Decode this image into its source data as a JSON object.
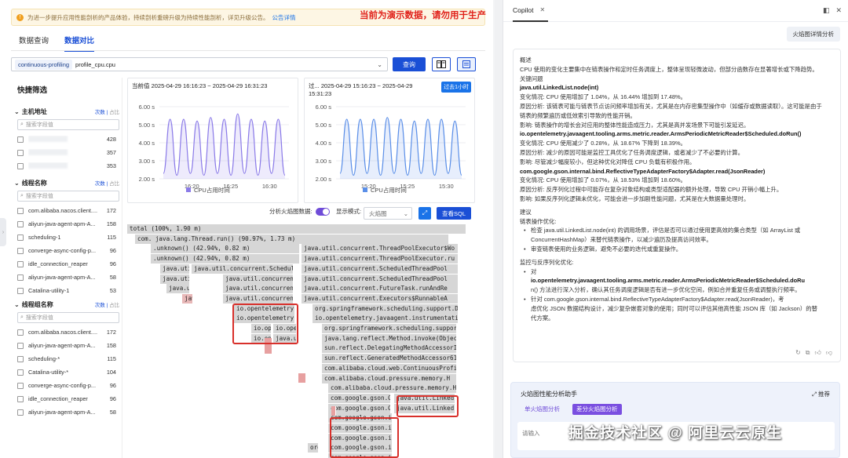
{
  "notice": {
    "text": "为进一步提升应用性能剖析的产品体验，持续剖析重磅升级为持续性能剖析，详见升级公告。",
    "link": "公告详情",
    "demo_warning": "当前为演示数据，请勿用于生产"
  },
  "tabs": [
    {
      "label": "数据查询",
      "active": false
    },
    {
      "label": "数据对比",
      "active": true
    }
  ],
  "query": {
    "chip": "continuous-profiling",
    "profile": "profile_cpu.cpu",
    "button": "查询"
  },
  "filter": {
    "title": "快捷筛选",
    "sort_count": "次数",
    "sort_ratio": "占比",
    "search_placeholder": "搜索字段值",
    "sections": [
      {
        "title": "主机地址",
        "items": [
          {
            "name": "",
            "count": "428"
          },
          {
            "name": "",
            "count": "357"
          },
          {
            "name": "",
            "count": "353"
          }
        ]
      },
      {
        "title": "线程名称",
        "items": [
          {
            "name": "com.alibaba.nacos.client....",
            "count": "172"
          },
          {
            "name": "aliyun-java-agent-apm-A...",
            "count": "158"
          },
          {
            "name": "scheduling-1",
            "count": "115"
          },
          {
            "name": "converge-async-config-p...",
            "count": "96"
          },
          {
            "name": "idle_connection_reaper",
            "count": "96"
          },
          {
            "name": "aliyun-java-agent-apm-A...",
            "count": "58"
          },
          {
            "name": "Catalina-utility-1",
            "count": "53"
          }
        ]
      },
      {
        "title": "线程组名称",
        "items": [
          {
            "name": "com.alibaba.nacos.client....",
            "count": "172"
          },
          {
            "name": "aliyun-java-agent-apm-A...",
            "count": "158"
          },
          {
            "name": "scheduling-*",
            "count": "115"
          },
          {
            "name": "Catalina-utility-*",
            "count": "104"
          },
          {
            "name": "converge-async-config-p...",
            "count": "96"
          },
          {
            "name": "idle_connection_reaper",
            "count": "96"
          },
          {
            "name": "aliyun-java-agent-apm-A...",
            "count": "58"
          }
        ]
      }
    ]
  },
  "charts": {
    "current": {
      "title": "当前值 2025-04-29 16:16:23 ~ 2025-04-29 16:31:23",
      "legend": "CPU占用时间"
    },
    "past": {
      "title_line1": "过... 2025-04-29 15:16:23 ~ 2025-04-29",
      "title_line2": "15:31:23",
      "range_button": "过去1小时",
      "legend": "CPU占用时间"
    }
  },
  "chart_data": [
    {
      "type": "area",
      "title": "",
      "ylabel": "",
      "xlabel": "",
      "ylim": [
        2,
        6
      ],
      "y_ticks": [
        "2.00 s",
        "3.00 s",
        "4.00 s",
        "5.00 s",
        "6.00 s"
      ],
      "x_ticks": [
        "16:20",
        "16:25",
        "16:30"
      ],
      "series": [
        {
          "name": "CPU占用时间",
          "values": [
            2.3,
            5.3,
            2.2,
            5.3,
            2.3,
            5.2,
            2.2,
            5.4,
            2.3,
            5.3,
            2.2,
            5.6,
            2.3,
            5.3,
            2.2,
            5.2,
            2.3,
            5.3,
            2.2
          ]
        }
      ]
    },
    {
      "type": "area",
      "title": "",
      "ylabel": "",
      "xlabel": "",
      "ylim": [
        2,
        6
      ],
      "y_ticks": [
        "2.00 s",
        "3.00 s",
        "4.00 s",
        "5.00 s",
        "6.00 s"
      ],
      "x_ticks": [
        "15:20",
        "15:25",
        "15:30"
      ],
      "series": [
        {
          "name": "CPU占用时间",
          "values": [
            2.3,
            5.3,
            2.2,
            5.3,
            2.3,
            5.3,
            2.2,
            5.4,
            2.3,
            5.3,
            2.2,
            5.2,
            2.3,
            5.3,
            2.2,
            5.3,
            2.3,
            5.2,
            2.2
          ]
        }
      ]
    }
  ],
  "flame_controls": {
    "analyze_label": "分析火焰图数据:",
    "mode_label": "显示模式:",
    "mode_value": "火焰图",
    "sql_button": "查看SQL"
  },
  "flame_rows": [
    {
      "text": "total (100%, 1.90 m)",
      "cls": ""
    },
    {
      "text": "com. java.lang.Thread.run() (90.97%, 1.73 m)",
      "cls": ""
    },
    {
      "text": ".unknown() (42.94%, 0.82 m)",
      "cls": ""
    },
    {
      "text": ".unknown() (42.94%, 0.82 m)",
      "cls": ""
    },
    {
      "text": "java.uti",
      "cls": ""
    },
    {
      "text": "java.util.concurrent.ScheduledT",
      "cls": ""
    },
    {
      "text": "java.uti",
      "cls": ""
    },
    {
      "text": "java.util.concurrent.S",
      "cls": ""
    },
    {
      "text": "java.uti",
      "cls": ""
    },
    {
      "text": "java.util.concurrent.F",
      "cls": ""
    },
    {
      "text": "jav",
      "cls": "pk"
    },
    {
      "text": "java.util.concurrent.E",
      "cls": ""
    },
    {
      "text": "io.opentelemetry.j",
      "cls": ""
    },
    {
      "text": "io.opentelemetry.j",
      "cls": ""
    },
    {
      "text": "io.oper",
      "cls": ""
    },
    {
      "text": "io.oper",
      "cls": ""
    },
    {
      "text": "io.ope",
      "cls": ""
    },
    {
      "text": "java.ut",
      "cls": ""
    },
    {
      "text": "java.util.concurrent.ThreadPoolExecutor$Wo",
      "cls": ""
    },
    {
      "text": "java.util.concurrent.ThreadPoolExecutor.ru",
      "cls": ""
    },
    {
      "text": "java.util.concurrent.ScheduledThreadPool",
      "cls": ""
    },
    {
      "text": "java.util.concurrent.ScheduledThreadPool",
      "cls": ""
    },
    {
      "text": "java.util.concurrent.FutureTask.runAndRe",
      "cls": ""
    },
    {
      "text": "java.util.concurrent.Executors$RunnableA",
      "cls": ""
    },
    {
      "text": "org.springframework.scheduling.support.D",
      "cls": ""
    },
    {
      "text": "io.opentelemetry.javaagent.instrumentatio",
      "cls": ""
    },
    {
      "text": "org.springframework.scheduling.suppor",
      "cls": ""
    },
    {
      "text": "java.lang.reflect.Method.invoke(Objec",
      "cls": ""
    },
    {
      "text": "sun.reflect.DelegatingMethodAccessorI",
      "cls": ""
    },
    {
      "text": "sun.reflect.GeneratedMethodAccessor61",
      "cls": ""
    },
    {
      "text": "com.alibaba.cloud.web.ContinuousProfi",
      "cls": ""
    },
    {
      "text": "com.alibaba.cloud.pressure.memory.H",
      "cls": ""
    },
    {
      "text": "com.alibaba.cloud.pressure.memory.Ho",
      "cls": ""
    },
    {
      "text": "com.google.gson.Gs",
      "cls": ""
    },
    {
      "text": "java.util.Linked",
      "cls": ""
    },
    {
      "text": "com.google.gson.Gs",
      "cls": ""
    },
    {
      "text": "java.util.Linked",
      "cls": ""
    },
    {
      "text": "com.google.gson.in",
      "cls": ""
    },
    {
      "text": "com.google.gson.in",
      "cls": ""
    },
    {
      "text": "com.google.gson.in",
      "cls": ""
    },
    {
      "text": "com.google.gson.in",
      "cls": ""
    },
    {
      "text": "org.",
      "cls": ""
    },
    {
      "text": "com.google.gson.in",
      "cls": ""
    }
  ],
  "copilot": {
    "tab": "Copilot",
    "user_bubble": "火焰图详情分析",
    "assist_title": "火焰图性能分析助手",
    "recommend": "推荐",
    "tab_single": "单火焰图分析",
    "tab_diff": "差分火焰图分析",
    "input_placeholder": "请输入",
    "lines": [
      {
        "t": "概述",
        "c": ""
      },
      {
        "t": "CPU 使用的变化主要集中在链表操作和定时任务调度上，整体呈现轻微波动，但部分函数存在显著增长或下降趋势。",
        "c": ""
      },
      {
        "t": "关键问题",
        "c": ""
      },
      {
        "t": "java.util.LinkedList.node(int)",
        "c": "b"
      },
      {
        "t": "变化情况: CPU 使用增加了 1.04%，从 16.44% 增加到 17.48%。",
        "c": ""
      },
      {
        "t": "原因分析: 该链表可能与链表节点访问频率增加有关，尤其是在内存密集型操作中（如缓存或数据读取）。这可能是由于",
        "c": ""
      },
      {
        "t": "链表的频繁遍历或低效索引导致的性能开销。",
        "c": ""
      },
      {
        "t": "影响: 链表操作的增长会对应用的整体性能造成压力，尤其是高并发场景下可能引发延迟。",
        "c": ""
      },
      {
        "t": "io.opentelemetry.javaagent.tooling.arms.metric.reader.ArmsPeriodicMetricReader$Scheduled.doRun()",
        "c": "b"
      },
      {
        "t": "变化情况: CPU 使用减少了 0.28%，从 18.67% 下降到 18.39%。",
        "c": ""
      },
      {
        "t": "原因分析: 减少的原因可能是监控工具优化了任务调度逻辑，或者减少了不必要的计算。",
        "c": ""
      },
      {
        "t": "影响: 尽管减少幅度较小，但这种优化对降低 CPU 负载有积极作用。",
        "c": ""
      },
      {
        "t": "com.google.gson.internal.bind.ReflectiveTypeAdapterFactory$Adapter.read(JsonReader)",
        "c": "b"
      },
      {
        "t": "变化情况: CPU 使用增加了 0.07%，从 18.53% 增加到 18.60%。",
        "c": ""
      },
      {
        "t": "原因分析: 反序列化过程中可能存在复杂对象结构或类型适配器的额外处理，导致 CPU 开销小幅上升。",
        "c": ""
      },
      {
        "t": "影响: 如果反序列化逻辑未优化，可能会进一步加剧性能问题，尤其是在大数据量处理时。",
        "c": ""
      },
      {
        "t": "建议",
        "c": "gap"
      },
      {
        "t": "链表操作优化:",
        "c": ""
      },
      {
        "t": "检查 java.util.LinkedList.node(int) 的调用场景，评估是否可以通过使用更高效的集合类型（如 ArrayList 或",
        "c": "li"
      },
      {
        "t": "ConcurrentHashMap）来替代链表操作，以减少遍历及提高访问效率。",
        "c": "ind"
      },
      {
        "t": "审查链表使用的业务逻辑，避免不必要的迭代或重复操作。",
        "c": "li"
      },
      {
        "t": "监控与反序列化优化:",
        "c": "gap"
      },
      {
        "t": "对",
        "c": "li"
      },
      {
        "t": "io.opentelemetry.javaagent.tooling.arms.metric.reader.ArmsPeriodicMetricReader$Scheduled.doRu",
        "c": "ind b"
      },
      {
        "t": "n() 方法进行深入分析，确认其任务调度逻辑是否有进一步优化空间，例如合并重复任务或调整执行频率。",
        "c": "ind"
      },
      {
        "t": "针对 com.google.gson.internal.bind.ReflectiveTypeAdapterFactory$Adapter.read(JsonReader)，考",
        "c": "li"
      },
      {
        "t": "虑优化 JSON 数据结构设计，减少复杂嵌套对象的使用；同时可以评估其他高性能 JSON 库（如 Jackson）的替",
        "c": "ind"
      },
      {
        "t": "代方案。",
        "c": "ind"
      }
    ]
  },
  "watermark": "掘金技术社区 @ 阿里云云原生"
}
